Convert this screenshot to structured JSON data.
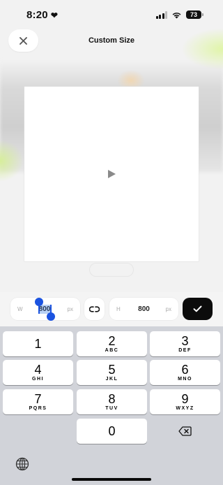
{
  "status": {
    "time": "8:20",
    "battery": "73"
  },
  "header": {
    "title": "Custom Size"
  },
  "size": {
    "width_prefix": "W",
    "width_value": "800",
    "width_unit": "px",
    "height_prefix": "H",
    "height_value": "800",
    "height_unit": "px"
  },
  "keypad": {
    "keys": [
      {
        "num": "1",
        "letters": ""
      },
      {
        "num": "2",
        "letters": "ABC"
      },
      {
        "num": "3",
        "letters": "DEF"
      },
      {
        "num": "4",
        "letters": "GHI"
      },
      {
        "num": "5",
        "letters": "JKL"
      },
      {
        "num": "6",
        "letters": "MNO"
      },
      {
        "num": "7",
        "letters": "PQRS"
      },
      {
        "num": "8",
        "letters": "TUV"
      },
      {
        "num": "9",
        "letters": "WXYZ"
      },
      {
        "num": "0",
        "letters": ""
      }
    ]
  },
  "icons": {
    "close": "close-icon",
    "play": "play-icon",
    "link": "link-icon",
    "confirm": "checkmark-icon",
    "delete": "backspace-icon",
    "globe": "globe-icon"
  },
  "colors": {
    "selection": "#b8d1f4",
    "handle": "#1b53e0",
    "confirm": "#0c0c0c"
  }
}
